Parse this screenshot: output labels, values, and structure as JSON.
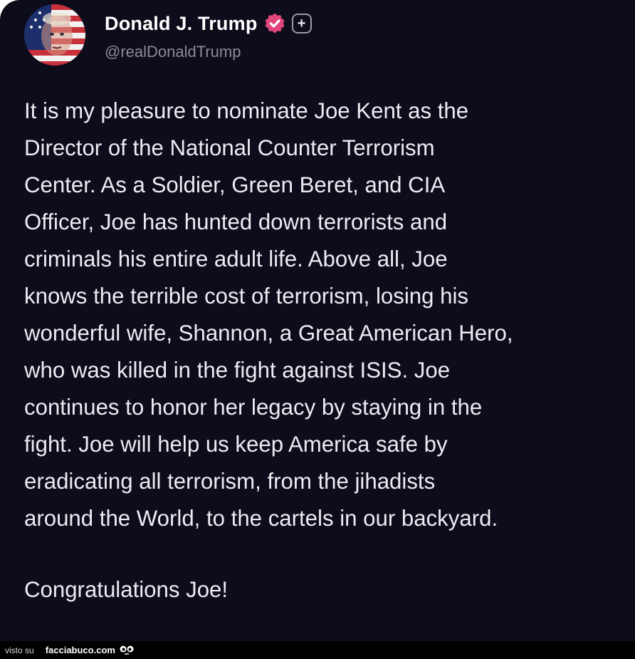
{
  "profile": {
    "display_name": "Donald J. Trump",
    "handle": "@realDonaldTrump",
    "avatar_icon": "flag-portrait-avatar",
    "verified_icon": "verified-badge-icon",
    "verified_color": "#e0457b",
    "plus_label": "+"
  },
  "post": {
    "lines": [
      "It is my pleasure to nominate Joe Kent as the",
      "Director of the National Counter Terrorism",
      "Center. As a Soldier, Green Beret, and CIA",
      "Officer, Joe has hunted down terrorists and",
      "criminals his entire adult life. Above all, Joe",
      "knows the terrible cost of terrorism, losing his",
      "wonderful wife, Shannon, a Great American Hero,",
      "who was killed in the fight against ISIS. Joe",
      "continues to honor her legacy by staying in the",
      "fight. Joe will help us keep America safe by",
      "eradicating all terrorism, from the jihadists",
      "around the World, to the cartels in our backyard."
    ],
    "closing": "Congratulations Joe!"
  },
  "footer": {
    "prefix": "visto su",
    "site": "facciabuco.com",
    "logo_icon": "facciabuco-face-icon"
  },
  "colors": {
    "background": "#0c0c1b",
    "text": "#ececf2",
    "handle": "#8a8a98"
  }
}
